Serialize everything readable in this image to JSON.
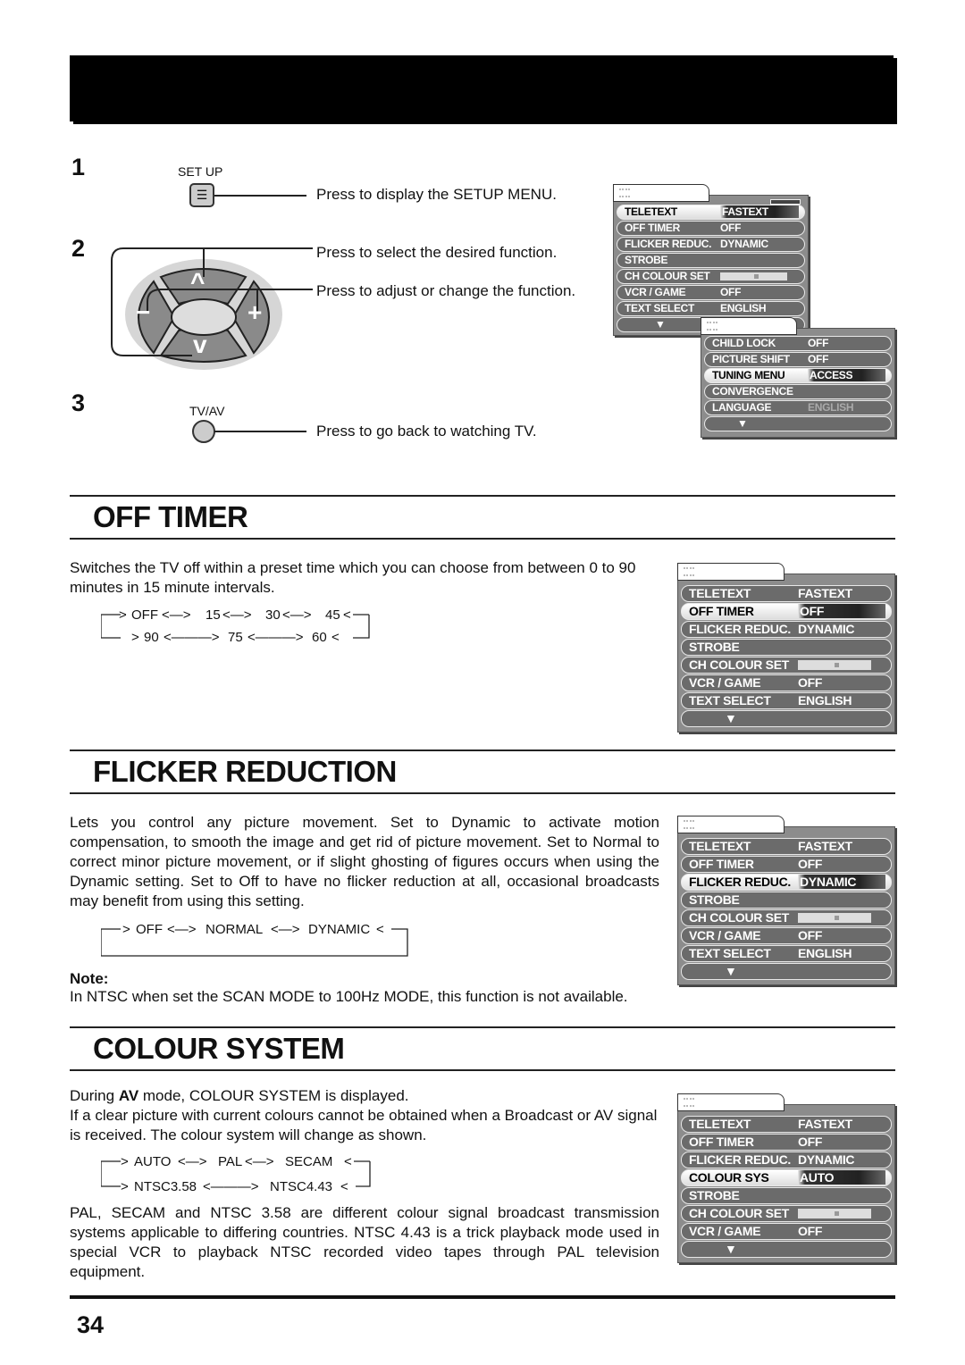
{
  "steps": [
    {
      "num": "1",
      "button_label": "SET UP",
      "instruction": "Press to display the SETUP MENU."
    },
    {
      "num": "2",
      "instructions": [
        "Press to select the desired function.",
        "Press to adjust or change the function."
      ]
    },
    {
      "num": "3",
      "button_label": "TV/AV",
      "instruction": "Press to go back to watching TV."
    }
  ],
  "remote_keys": {
    "up": "^",
    "down": "v",
    "minus": "−",
    "plus": "+"
  },
  "menus": {
    "setup": {
      "rows": [
        [
          "TELETEXT",
          "FASTEXT"
        ],
        [
          "OFF TIMER",
          "OFF"
        ],
        [
          "FLICKER REDUC.",
          "DYNAMIC"
        ],
        [
          "STROBE",
          ""
        ],
        [
          "CH COLOUR SET",
          "slider"
        ],
        [
          "VCR / GAME",
          "OFF"
        ],
        [
          "TEXT SELECT",
          "ENGLISH"
        ],
        [
          "▼",
          ""
        ]
      ],
      "selected": 0
    },
    "setup_page2": {
      "rows": [
        [
          "CHILD LOCK",
          "OFF"
        ],
        [
          "PICTURE SHIFT",
          "OFF"
        ],
        [
          "TUNING MENU",
          "ACCESS"
        ],
        [
          "CONVERGENCE",
          ""
        ],
        [
          "LANGUAGE",
          "ENGLISH"
        ],
        [
          "▼",
          ""
        ]
      ],
      "selected": 2,
      "dimmed": 4
    },
    "off_timer": {
      "rows": [
        [
          "TELETEXT",
          "FASTEXT"
        ],
        [
          "OFF TIMER",
          "OFF"
        ],
        [
          "FLICKER REDUC.",
          "DYNAMIC"
        ],
        [
          "STROBE",
          ""
        ],
        [
          "CH COLOUR SET",
          "slider"
        ],
        [
          "VCR / GAME",
          "OFF"
        ],
        [
          "TEXT SELECT",
          "ENGLISH"
        ],
        [
          "▼",
          ""
        ]
      ],
      "selected": 1
    },
    "flicker": {
      "rows": [
        [
          "TELETEXT",
          "FASTEXT"
        ],
        [
          "OFF TIMER",
          "OFF"
        ],
        [
          "FLICKER REDUC.",
          "DYNAMIC"
        ],
        [
          "STROBE",
          ""
        ],
        [
          "CH COLOUR SET",
          "slider"
        ],
        [
          "VCR / GAME",
          "OFF"
        ],
        [
          "TEXT SELECT",
          "ENGLISH"
        ],
        [
          "▼",
          ""
        ]
      ],
      "selected": 2
    },
    "colour": {
      "rows": [
        [
          "TELETEXT",
          "FASTEXT"
        ],
        [
          "OFF TIMER",
          "OFF"
        ],
        [
          "FLICKER REDUC.",
          "DYNAMIC"
        ],
        [
          "COLOUR SYS",
          "AUTO"
        ],
        [
          "STROBE",
          ""
        ],
        [
          "CH COLOUR SET",
          "slider"
        ],
        [
          "VCR / GAME",
          "OFF"
        ],
        [
          "▼",
          ""
        ]
      ],
      "selected": 3
    }
  },
  "off_timer": {
    "title": "OFF TIMER",
    "text": "Switches the TV off within a preset time which you can choose from between 0 to 90 minutes in 15 minute intervals.",
    "cycle": [
      "OFF",
      "15",
      "30",
      "45",
      "60",
      "75",
      "90"
    ]
  },
  "flicker": {
    "title": "FLICKER REDUCTION",
    "text": "Lets you control any picture movement. Set to Dynamic to activate motion compensation, to smooth the image and get rid of picture movement. Set to Normal to correct minor picture movement, or if slight ghosting of figures occurs when using the Dynamic setting. Set to Off to have no flicker reduction at all, occasional broadcasts may benefit from using this setting.",
    "cycle": [
      "OFF",
      "NORMAL",
      "DYNAMIC"
    ],
    "note_label": "Note:",
    "note": "In NTSC when set the SCAN MODE to 100Hz MODE, this function is not available."
  },
  "colour": {
    "title": "COLOUR SYSTEM",
    "text1_pre": "During ",
    "text1_bold": "AV",
    "text1_post": " mode, COLOUR SYSTEM is displayed.",
    "text2": "If a clear picture with current colours cannot be obtained when a Broadcast or AV signal is received. The colour system will change as shown.",
    "cycle": [
      "AUTO",
      "PAL",
      "SECAM",
      "NTSC4.43",
      "NTSC3.58"
    ],
    "text3": "PAL, SECAM and NTSC 3.58 are different colour signal broadcast transmission systems applicable to differing countries. NTSC 4.43 is a trick playback mode used in special VCR to playback NTSC recorded video tapes through PAL television equipment."
  },
  "page_number": "34"
}
